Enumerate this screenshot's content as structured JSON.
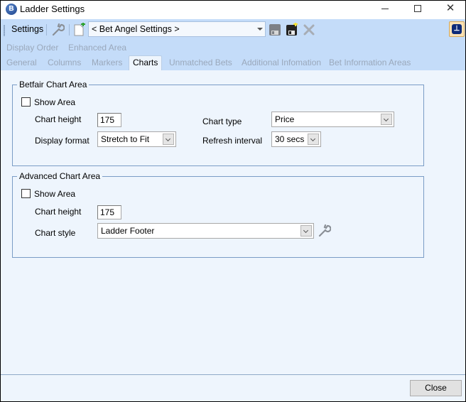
{
  "window": {
    "title": "Ladder Settings",
    "app_icon": "bet-angel-logo-icon",
    "controls": [
      "minimize",
      "maximize",
      "close"
    ]
  },
  "toolbar": {
    "settings_label": "Settings",
    "profile_select": {
      "value": "< Bet Angel Settings >"
    },
    "icons": [
      "wrench-icon",
      "new-document-icon",
      "save-icon",
      "save-as-icon",
      "delete-icon",
      "pin-icon"
    ]
  },
  "subnav": [
    "Display Order",
    "Enhanced Area"
  ],
  "tabs": [
    {
      "label": "General",
      "active": false
    },
    {
      "label": "Columns",
      "active": false
    },
    {
      "label": "Markers",
      "active": false
    },
    {
      "label": "Charts",
      "active": true
    },
    {
      "label": "Unmatched Bets",
      "active": false
    },
    {
      "label": "Additional Infomation",
      "active": false
    },
    {
      "label": "Bet Information Areas",
      "active": false
    }
  ],
  "betfair_chart": {
    "title": "Betfair Chart Area",
    "show_area_label": "Show Area",
    "show_area_checked": false,
    "chart_height_label": "Chart height",
    "chart_height_value": "175",
    "display_format_label": "Display format",
    "display_format_value": "Stretch to Fit",
    "chart_type_label": "Chart type",
    "chart_type_value": "Price",
    "refresh_interval_label": "Refresh interval",
    "refresh_interval_value": "30 secs"
  },
  "advanced_chart": {
    "title": "Advanced Chart Area",
    "show_area_label": "Show Area",
    "show_area_checked": false,
    "chart_height_label": "Chart height",
    "chart_height_value": "175",
    "chart_style_label": "Chart style",
    "chart_style_value": "Ladder Footer"
  },
  "footer": {
    "close_label": "Close"
  }
}
